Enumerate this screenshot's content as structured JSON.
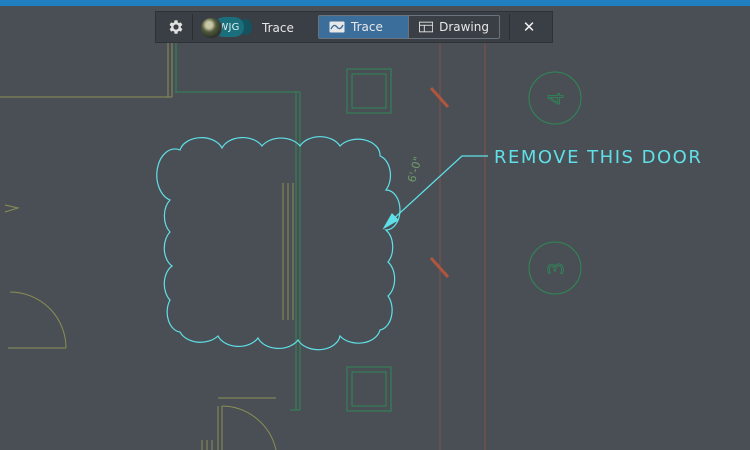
{
  "toolbar": {
    "avatar_initials": "WJG",
    "trace_name": "Trace",
    "tabs": [
      {
        "label": "Trace",
        "active": true
      },
      {
        "label": "Drawing",
        "active": false
      }
    ],
    "close_symbol": "✕",
    "icons": {
      "settings": "gear-icon",
      "trace_tab": "wave-icon",
      "drawing_tab": "sheet-icon",
      "close": "close-icon"
    }
  },
  "markup": {
    "annotation_text": "REMOVE THIS DOOR",
    "tag_1": "4",
    "tag_2": "3",
    "dimension": "6'-0\""
  },
  "colors": {
    "background": "#4a4f55",
    "accent_bar": "#1f7fc0",
    "markup": "#5fe0e8",
    "floorplan_lines": "#8a8f55",
    "floorplan_green": "#2e8a57",
    "gridline_red": "#b0563f",
    "active_tab": "#3c6e9c"
  }
}
